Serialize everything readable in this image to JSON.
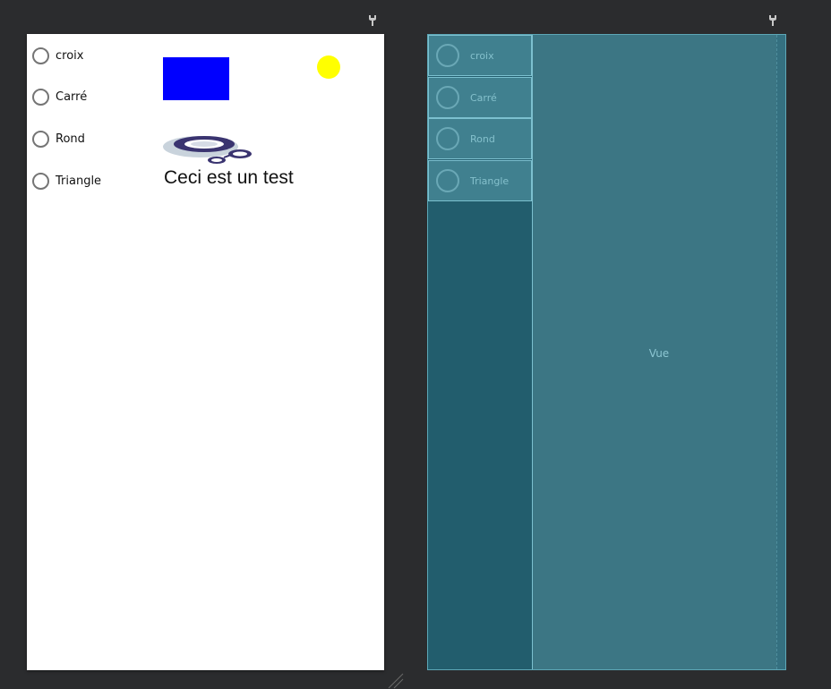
{
  "design_view": {
    "radio_options": [
      {
        "label": "croix"
      },
      {
        "label": "Carré"
      },
      {
        "label": "Rond"
      },
      {
        "label": "Triangle"
      }
    ],
    "shape_rect_color": "#0000ff",
    "shape_circle_color": "#ffff00",
    "logo_icon": "rings-logo-icon",
    "text": "Ceci est un test"
  },
  "blueprint_view": {
    "radio_options": [
      {
        "label": "croix"
      },
      {
        "label": "Carré"
      },
      {
        "label": "Rond"
      },
      {
        "label": "Triangle"
      }
    ],
    "view_label": "Vue"
  },
  "icons": {
    "toolbar_left": "wrench-icon",
    "toolbar_right": "wrench-icon",
    "resize": "resize-handle-icon"
  },
  "colors": {
    "background": "#2b2c2e",
    "blueprint_bg": "#225d6d",
    "blueprint_view": "#3c7684",
    "blueprint_border": "#7cc0cf"
  }
}
